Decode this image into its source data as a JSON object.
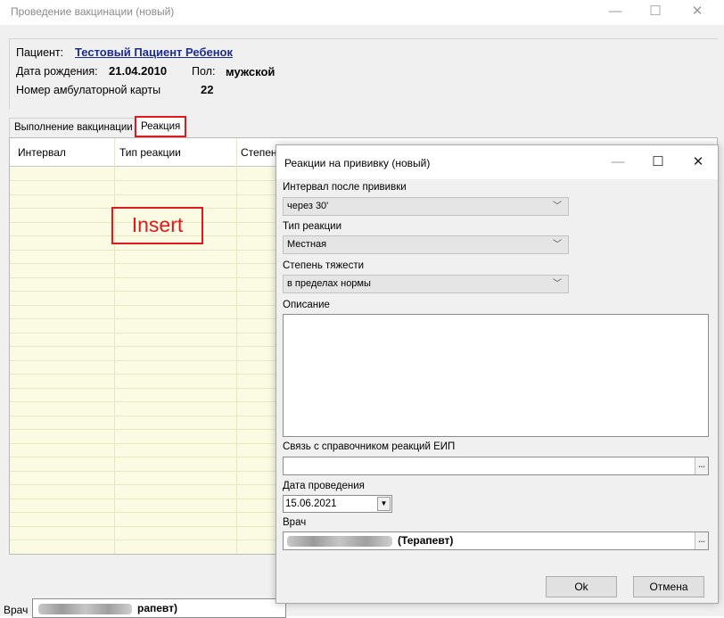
{
  "window": {
    "title": "Проведение вакцинации (новый)"
  },
  "patient": {
    "label": "Пациент:",
    "name": "Тестовый Пациент Ребенок",
    "dob_label": "Дата рождения:",
    "dob": "21.04.2010",
    "sex_label": "Пол:",
    "sex": "мужской",
    "card_label": "Номер амбулаторной карты",
    "card_number": "22"
  },
  "tabs": [
    {
      "label": "Выполнение вакцинации",
      "active": false
    },
    {
      "label": "Реакция",
      "active": true
    }
  ],
  "grid": {
    "columns": [
      "Интервал",
      "Тип реакции",
      "Степен"
    ]
  },
  "annotation": {
    "text": "Insert",
    "color": "#e0191f"
  },
  "bottom": {
    "doctor_label": "Врач",
    "doctor_value": "рапевт)"
  },
  "dialog": {
    "title": "Реакции на прививку (новый)",
    "interval_label": "Интервал после прививки",
    "interval_value": "через 30'",
    "type_label": "Тип реакции",
    "type_value": "Местная",
    "severity_label": "Степень тяжести",
    "severity_value": "в пределах нормы",
    "description_label": "Описание",
    "description_value": "",
    "eip_label": "Связь с справочником реакций ЕИП",
    "eip_value": "",
    "date_label": "Дата проведения",
    "date_value": "15.06.2021",
    "doctor_label": "Врач",
    "doctor_value": "(Терапевт)",
    "ok_label": "Ok",
    "cancel_label": "Отмена"
  },
  "icons": {
    "minimize": "minimize-icon",
    "maximize": "maximize-icon",
    "close": "close-icon",
    "dropdown": "chevron-down-icon",
    "ellipsis": "ellipsis-icon"
  }
}
